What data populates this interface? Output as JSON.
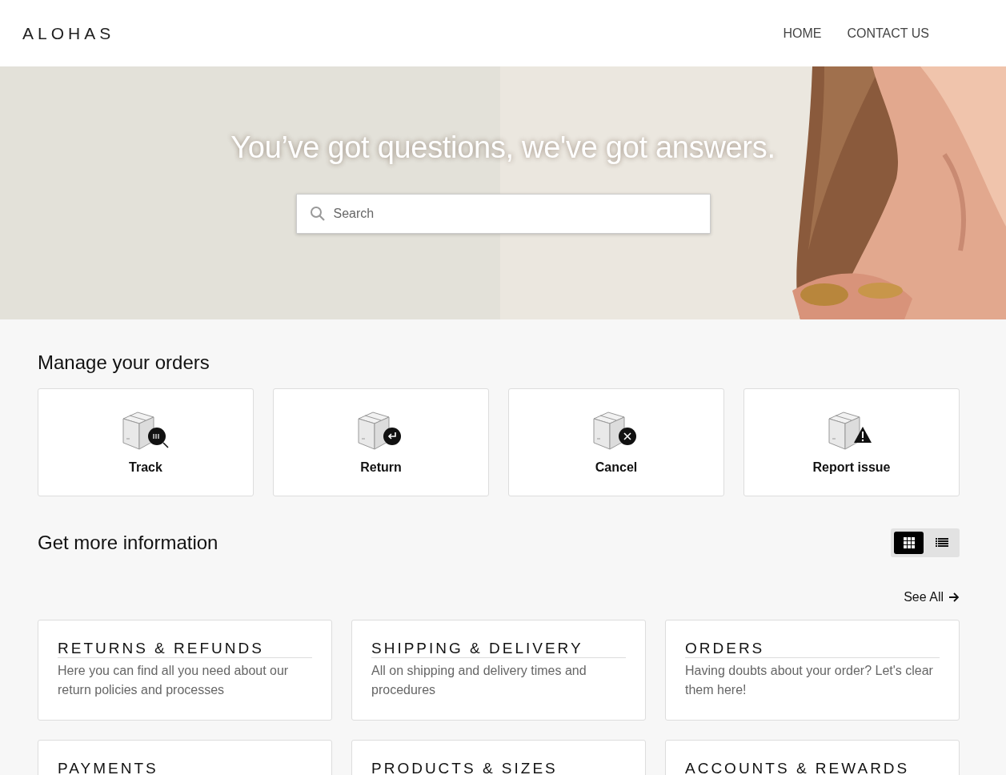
{
  "header": {
    "logo": "ALOHAS",
    "nav": [
      {
        "label": "HOME"
      },
      {
        "label": "CONTACT US"
      }
    ]
  },
  "hero": {
    "kind": "picture",
    "title": "You’ve got questions, we've got answers.",
    "search": {
      "placeholder": "Search"
    }
  },
  "manage": {
    "title": "Manage your orders",
    "actions": [
      {
        "label": "Track",
        "kind": "track"
      },
      {
        "label": "Return",
        "kind": "return"
      },
      {
        "label": "Cancel",
        "kind": "cancel"
      },
      {
        "label": "Report issue",
        "kind": "report"
      }
    ]
  },
  "info": {
    "title": "Get more information",
    "views": [
      {
        "kind": "grid",
        "selected": true
      },
      {
        "kind": "list",
        "selected": false
      }
    ],
    "see_all": "See All",
    "categories": [
      {
        "title": "RETURNS & REFUNDS",
        "description": "Here you can find all you need about our return policies and processes"
      },
      {
        "title": "SHIPPING & DELIVERY",
        "description": "All on shipping and delivery times and procedures"
      },
      {
        "title": "ORDERS",
        "description": "Having doubts about your order? Let's clear them here!"
      },
      {
        "title": "PAYMENTS"
      },
      {
        "title": "PRODUCTS & SIZES"
      },
      {
        "title": "ACCOUNTS & REWARDS"
      }
    ]
  }
}
